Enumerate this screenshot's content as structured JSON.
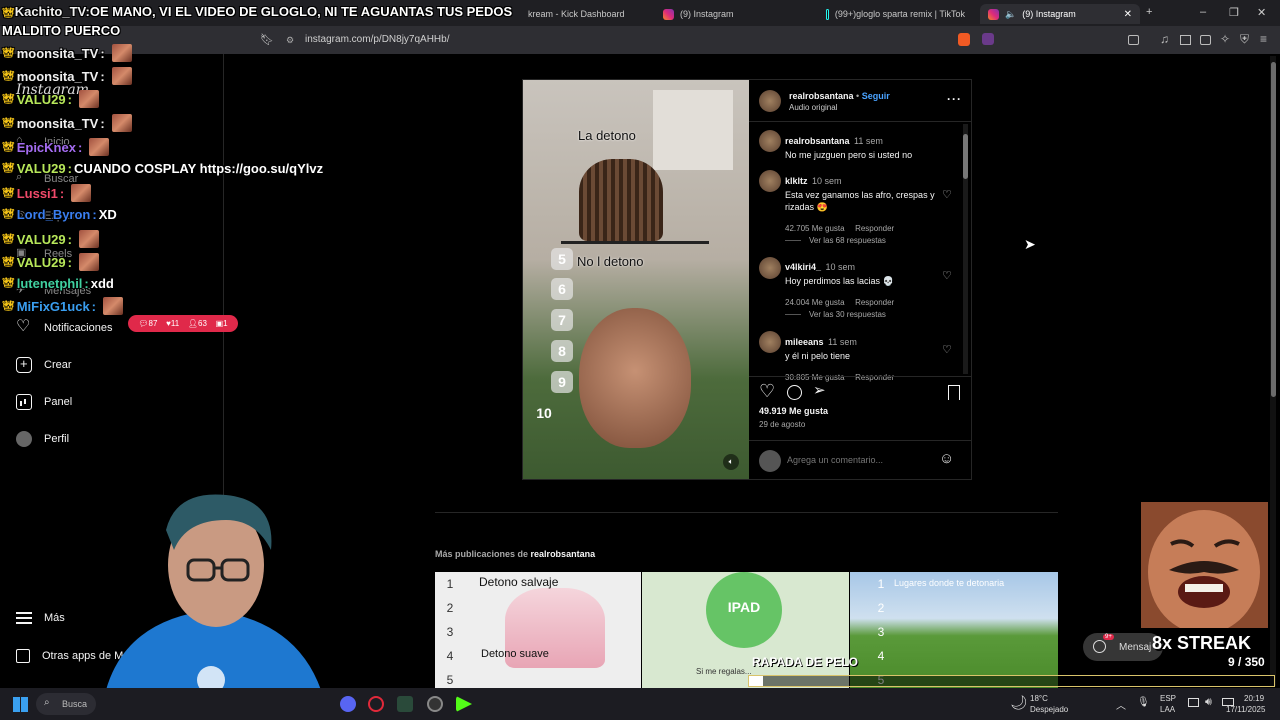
{
  "browser": {
    "tabs": [
      {
        "label": "",
        "active": false
      },
      {
        "label": "kream - Kick Dashboard",
        "active": false
      },
      {
        "label": "(9) Instagram",
        "active": false
      },
      {
        "label": "(99+)gloglo sparta remix | TikTok",
        "active": false
      },
      {
        "label": "(9) Instagram",
        "active": true
      }
    ],
    "url": "instagram.com/p/DN8jy7qAHHb/",
    "new_tab_icon": "plus-icon"
  },
  "ig_sidebar": {
    "logo": "Instagram",
    "items": [
      {
        "label": "Inicio",
        "icon": "home-icon"
      },
      {
        "label": "Buscar",
        "icon": "search-icon"
      },
      {
        "label": "Explorar",
        "icon": "compass-icon"
      },
      {
        "label": "Reels",
        "icon": "reels-icon"
      },
      {
        "label": "Mensajes",
        "icon": "messages-icon"
      },
      {
        "label": "Notificaciones",
        "icon": "heart-icon"
      },
      {
        "label": "Crear",
        "icon": "plus-icon"
      },
      {
        "label": "Panel",
        "icon": "chart-icon"
      },
      {
        "label": "Perfil",
        "icon": "avatar-icon"
      }
    ],
    "bottom": [
      {
        "label": "Más",
        "icon": "menu-icon"
      },
      {
        "label": "Otras apps de M",
        "icon": "grid-icon"
      }
    ],
    "notif_badge": {
      "comments": "87",
      "likes": "11",
      "follows": "63",
      "other": "1"
    }
  },
  "chat": [
    {
      "user": "Kachito_TV",
      "color": "#f0f0f0",
      "message": "OE MANO, VI EL VIDEO DE GLOGLO, NI TE AGUANTAS TUS PEDOS MALDITO PUERCO"
    },
    {
      "user": "moonsita_TV",
      "color": "#f0f0f0",
      "message": ""
    },
    {
      "user": "moonsita_TV",
      "color": "#f0f0f0",
      "message": ""
    },
    {
      "user": "VALU29",
      "color": "#b8e85a",
      "message": ""
    },
    {
      "user": "moonsita_TV",
      "color": "#f0f0f0",
      "message": ""
    },
    {
      "user": "EpicKnex",
      "color": "#a46cf0",
      "message": ""
    },
    {
      "user": "VALU29",
      "color": "#b8e85a",
      "message": "CUANDO COSPLAY https://goo.su/qYlvz"
    },
    {
      "user": "Lussi1",
      "color": "#f04a6a",
      "message": ""
    },
    {
      "user": "Lord_Byron",
      "color": "#3a7ef0",
      "message": "XD"
    },
    {
      "user": "VALU29",
      "color": "#b8e85a",
      "message": ""
    },
    {
      "user": "VALU29",
      "color": "#b8e85a",
      "message": ""
    },
    {
      "user": "lutenetphil",
      "color": "#40d0a0",
      "message": "xdd"
    },
    {
      "user": "MiFixG1uck",
      "color": "#3a9ef0",
      "message": ""
    }
  ],
  "post": {
    "author": "realrobsantana",
    "follow": "Seguir",
    "audio": "Audio original",
    "media": {
      "text_top": "La detono",
      "text_mid": "No l detono",
      "numbers": [
        "5",
        "6",
        "7",
        "8",
        "9",
        "10"
      ]
    },
    "comments": [
      {
        "user": "realrobsantana",
        "time": "11 sem",
        "text": "No me juzguen pero si usted no",
        "likes": "",
        "reply": ""
      },
      {
        "user": "klkltz",
        "time": "10 sem",
        "text": "Esta vez ganamos las afro, crespas y rizadas 😍",
        "likes": "42.705 Me gusta",
        "reply": "Responder",
        "replies": "Ver las 68 respuestas"
      },
      {
        "user": "v4lkiri4_",
        "time": "10 sem",
        "text": "Hoy perdimos las lacias 💀",
        "likes": "24.004 Me gusta",
        "reply": "Responder",
        "replies": "Ver las 30 respuestas"
      },
      {
        "user": "mileeans",
        "time": "11 sem",
        "text": "y él ni pelo tiene",
        "likes": "30.805 Me gusta",
        "reply": "Responder"
      }
    ],
    "likes": "49.919 Me gusta",
    "date": "29 de agosto",
    "comment_placeholder": "Agrega un comentario..."
  },
  "more_posts": {
    "title_prefix": "Más publicaciones de",
    "title_user": "realrobsantana",
    "thumbs": [
      {
        "text_a": "Detono salvaje",
        "text_b": "Detono suave"
      },
      {
        "text_a": "IPAD",
        "text_b": "Si me regalas..."
      },
      {
        "text_a": "Lugares donde te detonaria",
        "text_b": ""
      }
    ]
  },
  "overlays": {
    "streak_label": "8x STREAK",
    "streak_sub": "Mensaj",
    "streak_badge": "9+",
    "goal_label": "RAPADA DE PELO",
    "goal_current": "9",
    "goal_total": "/ 350",
    "goal_fraction": 0.026
  },
  "taskbar": {
    "search": "Busca",
    "weather_temp": "18°C",
    "weather_desc": "Despejado",
    "lang": "ESP",
    "lang2": "LAA",
    "time": "20:19",
    "date": "17/11/2025"
  },
  "colors": {
    "ig_bg": "#000000",
    "notif_red": "#e0294a",
    "link_blue": "#4aa3ff",
    "taskbar": "#1c1c22"
  }
}
